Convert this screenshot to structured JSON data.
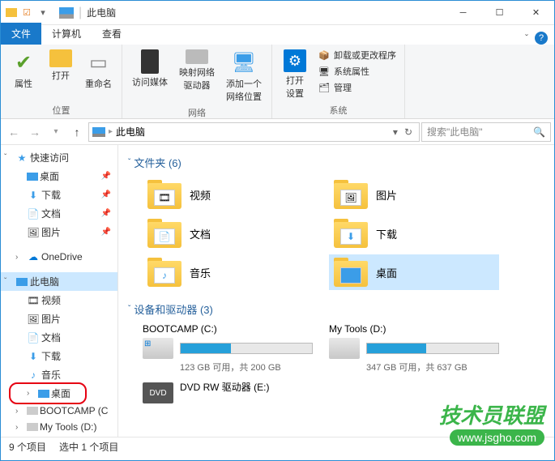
{
  "titlebar": {
    "title": "此电脑"
  },
  "tabs": {
    "file": "文件",
    "computer": "计算机",
    "view": "查看"
  },
  "ribbon": {
    "location": {
      "properties": "属性",
      "open": "打开",
      "rename": "重命名",
      "label": "位置"
    },
    "network": {
      "media": "访问媒体",
      "map_drive": "映射网络\n驱动器",
      "add_location": "添加一个\n网络位置",
      "label": "网络"
    },
    "system": {
      "settings": "打开\n设置",
      "uninstall": "卸载或更改程序",
      "sys_props": "系统属性",
      "manage": "管理",
      "label": "系统"
    }
  },
  "nav": {
    "breadcrumb": "此电脑",
    "search_placeholder": "搜索\"此电脑\""
  },
  "sidebar": {
    "quick_access": "快速访问",
    "qa_items": [
      {
        "label": "桌面"
      },
      {
        "label": "下载"
      },
      {
        "label": "文档"
      },
      {
        "label": "图片"
      }
    ],
    "onedrive": "OneDrive",
    "this_pc": "此电脑",
    "pc_items": [
      {
        "label": "视频"
      },
      {
        "label": "图片"
      },
      {
        "label": "文档"
      },
      {
        "label": "下载"
      },
      {
        "label": "音乐"
      },
      {
        "label": "桌面"
      },
      {
        "label": "BOOTCAMP (C"
      },
      {
        "label": "My Tools (D:)"
      }
    ]
  },
  "content": {
    "folders_header": "文件夹 (6)",
    "folders": [
      {
        "label": "视频"
      },
      {
        "label": "图片"
      },
      {
        "label": "文档"
      },
      {
        "label": "下载"
      },
      {
        "label": "音乐"
      },
      {
        "label": "桌面"
      }
    ],
    "drives_header": "设备和驱动器 (3)",
    "drives": [
      {
        "name": "BOOTCAMP (C:)",
        "info": "123 GB 可用，共 200 GB",
        "fill": 38
      },
      {
        "name": "My Tools (D:)",
        "info": "347 GB 可用，共 637 GB",
        "fill": 45
      },
      {
        "name": "DVD RW 驱动器 (E:)",
        "info": "",
        "fill": -1
      }
    ]
  },
  "statusbar": {
    "items": "9 个项目",
    "selected": "选中 1 个项目"
  },
  "watermark": {
    "line1": "技术员联盟",
    "line2": "www.jsgho.com"
  }
}
